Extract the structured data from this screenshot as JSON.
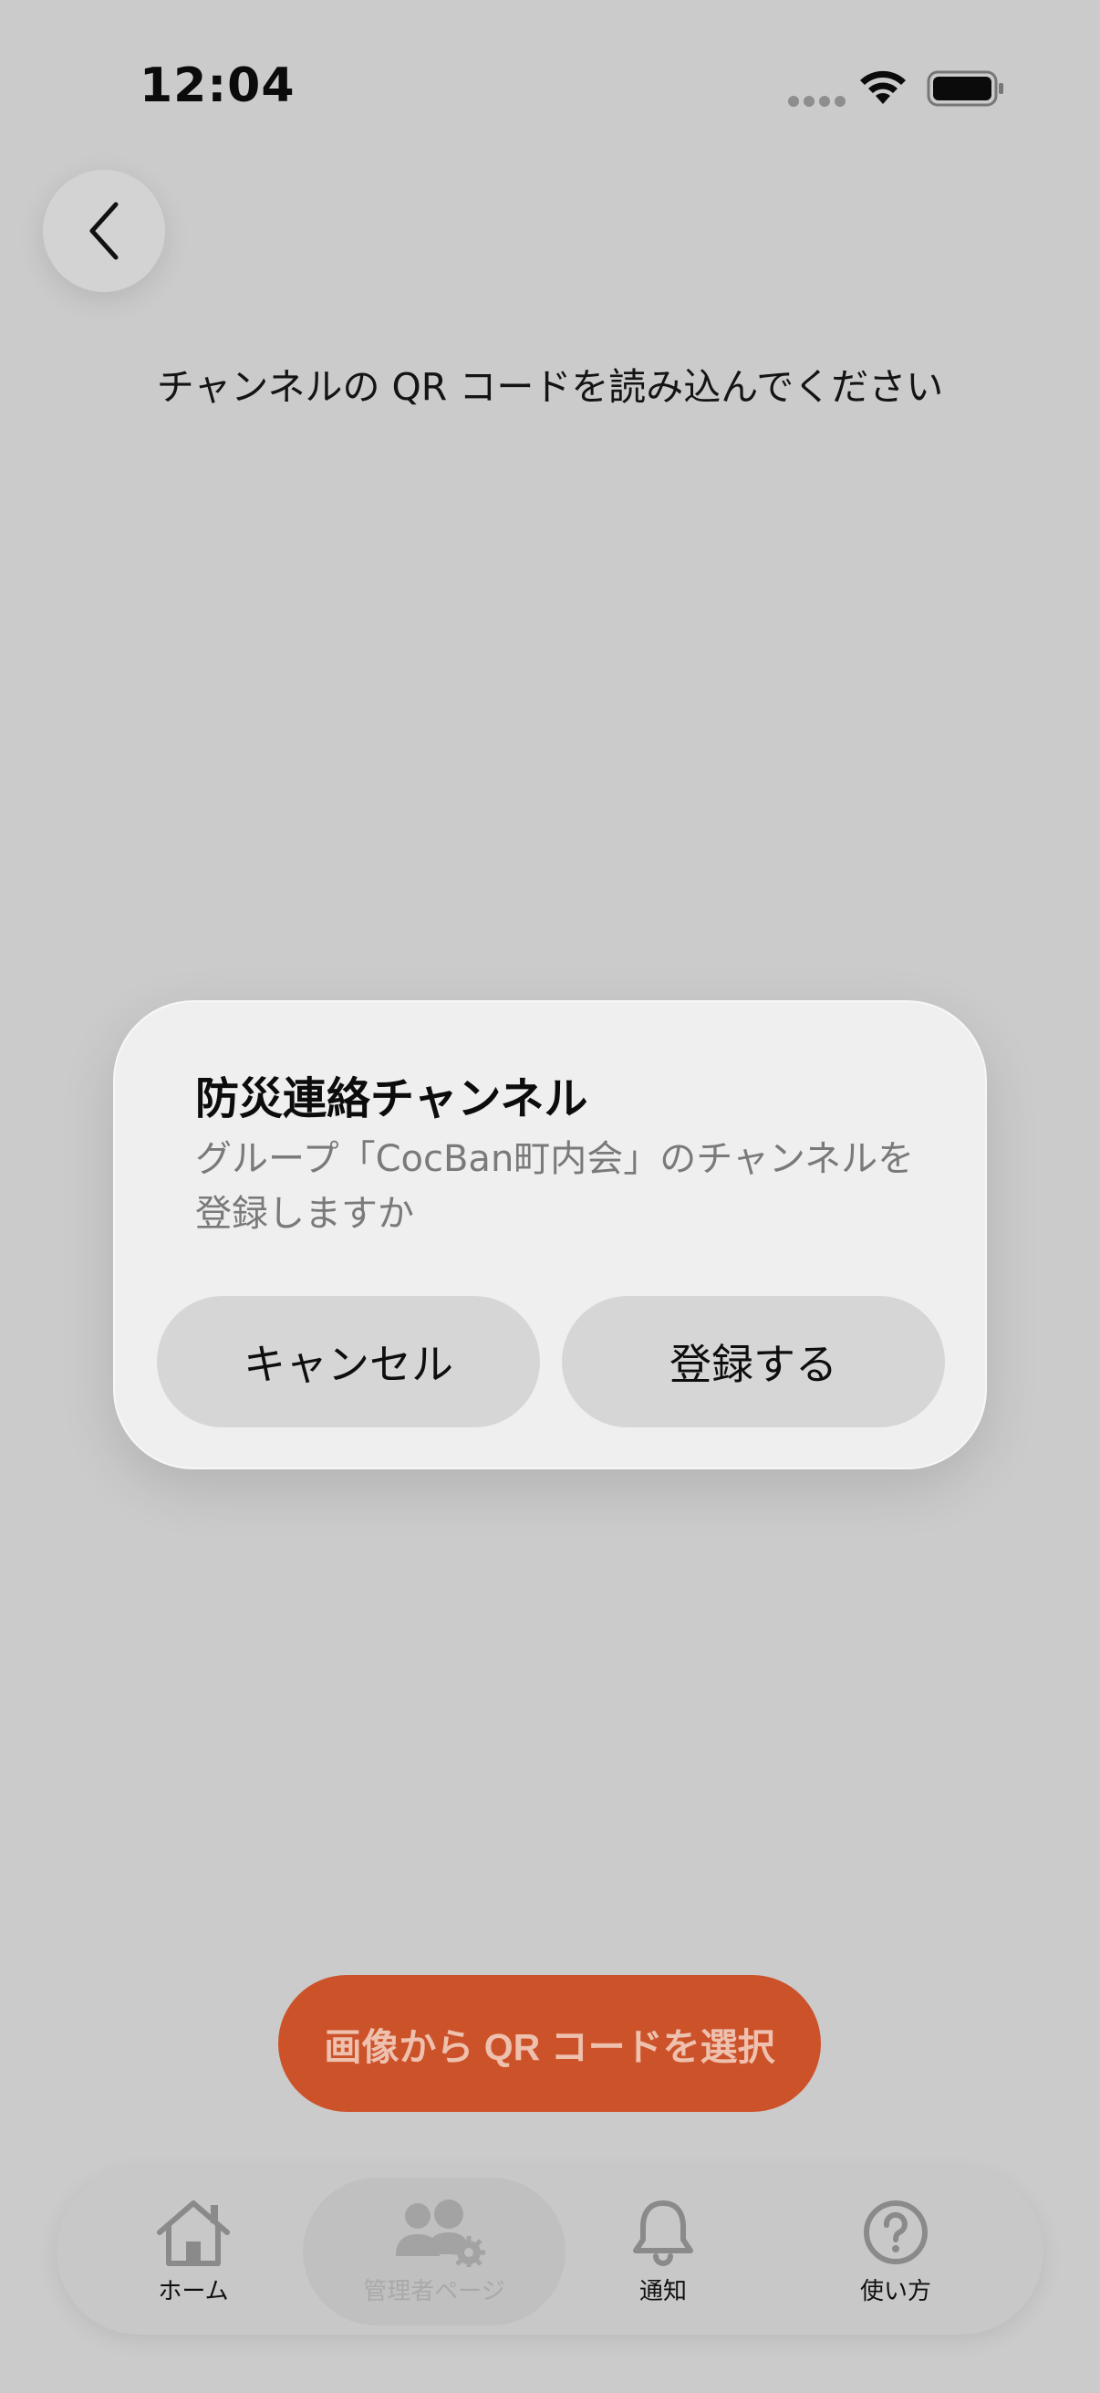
{
  "status_bar": {
    "time": "12:04"
  },
  "header": {
    "back_icon": "chevron-left-icon",
    "instruction": "チャンネルの QR コードを読み込んでください"
  },
  "dialog": {
    "title": "防災連絡チャンネル",
    "message": "グループ「CocBan町内会」のチャンネルを登録しますか",
    "cancel_label": "キャンセル",
    "confirm_label": "登録する"
  },
  "actions": {
    "select_qr_label": "画像から QR コードを選択",
    "accent_color": "#cc522a"
  },
  "tab_bar": {
    "items": [
      {
        "label": "ホーム",
        "icon": "home-icon"
      },
      {
        "label": "管理者ページ",
        "icon": "admin-users-gear-icon",
        "active": true
      },
      {
        "label": "通知",
        "icon": "bell-icon"
      },
      {
        "label": "使い方",
        "icon": "question-circle-icon"
      }
    ]
  }
}
